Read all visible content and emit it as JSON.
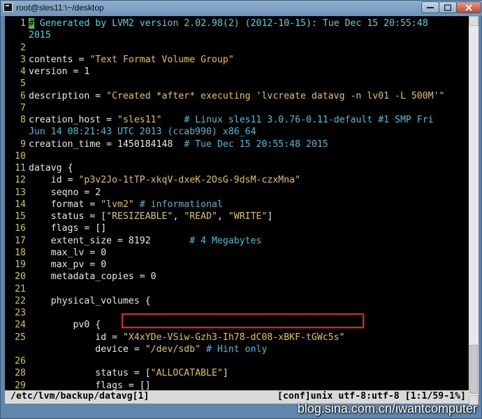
{
  "window": {
    "title": "root@sles11:\\~/desktop"
  },
  "terminal": {
    "lines": [
      {
        "n": "1",
        "parts": [
          {
            "t": "#",
            "c": "cursor"
          },
          {
            "t": " Generated by LVM2 version 2.02.98(2) (2012-10-15): Tue Dec 15 20:55:48",
            "c": "cyan"
          }
        ]
      },
      {
        "n": "",
        "parts": [
          {
            "t": "2015",
            "c": "cyan"
          }
        ]
      },
      {
        "n": "2",
        "parts": []
      },
      {
        "n": "3",
        "parts": [
          {
            "t": "contents = ",
            "c": ""
          },
          {
            "t": "\"Text Format Volume Group\"",
            "c": "str"
          }
        ]
      },
      {
        "n": "4",
        "parts": [
          {
            "t": "version = 1",
            "c": ""
          }
        ]
      },
      {
        "n": "5",
        "parts": []
      },
      {
        "n": "6",
        "parts": [
          {
            "t": "description = ",
            "c": ""
          },
          {
            "t": "\"Created *after* executing 'lvcreate datavg -n lv01 -L 500M'\"",
            "c": "str"
          }
        ]
      },
      {
        "n": "7",
        "parts": []
      },
      {
        "n": "8",
        "parts": [
          {
            "t": "creation_host = ",
            "c": ""
          },
          {
            "t": "\"sles11\"",
            "c": "str"
          },
          {
            "t": "    # Linux sles11 3.0.76-0.11-default #1 SMP Fri",
            "c": "com"
          }
        ]
      },
      {
        "n": "",
        "parts": [
          {
            "t": "Jun 14 08:21:43 UTC 2013 (ccab990) x86_64",
            "c": "com"
          }
        ]
      },
      {
        "n": "9",
        "parts": [
          {
            "t": "creation_time = 1450184148  ",
            "c": ""
          },
          {
            "t": "# Tue Dec 15 20:55:48 2015",
            "c": "com"
          }
        ]
      },
      {
        "n": "10",
        "parts": []
      },
      {
        "n": "11",
        "parts": [
          {
            "t": "datavg {",
            "c": ""
          }
        ]
      },
      {
        "n": "12",
        "parts": [
          {
            "t": "    id = ",
            "c": ""
          },
          {
            "t": "\"p3v2Jo-1tTP-xkqV-dxeK-2OsG-9dsM-czxMna\"",
            "c": "str"
          }
        ]
      },
      {
        "n": "13",
        "parts": [
          {
            "t": "    seqno = 2",
            "c": ""
          }
        ]
      },
      {
        "n": "14",
        "parts": [
          {
            "t": "    format = ",
            "c": ""
          },
          {
            "t": "\"lvm2\"",
            "c": "str"
          },
          {
            "t": " # informational",
            "c": "com"
          }
        ]
      },
      {
        "n": "15",
        "parts": [
          {
            "t": "    status = [",
            "c": ""
          },
          {
            "t": "\"RESIZEABLE\"",
            "c": "str"
          },
          {
            "t": ", ",
            "c": ""
          },
          {
            "t": "\"READ\"",
            "c": "str"
          },
          {
            "t": ", ",
            "c": ""
          },
          {
            "t": "\"WRITE\"",
            "c": "str"
          },
          {
            "t": "]",
            "c": ""
          }
        ]
      },
      {
        "n": "16",
        "parts": [
          {
            "t": "    flags = []",
            "c": ""
          }
        ]
      },
      {
        "n": "17",
        "parts": [
          {
            "t": "    extent_size = 8192       ",
            "c": ""
          },
          {
            "t": "# 4 Megabytes",
            "c": "com"
          }
        ]
      },
      {
        "n": "18",
        "parts": [
          {
            "t": "    max_lv = 0",
            "c": ""
          }
        ]
      },
      {
        "n": "19",
        "parts": [
          {
            "t": "    max_pv = 0",
            "c": ""
          }
        ]
      },
      {
        "n": "20",
        "parts": [
          {
            "t": "    metadata_copies = 0",
            "c": ""
          }
        ]
      },
      {
        "n": "21",
        "parts": []
      },
      {
        "n": "22",
        "parts": [
          {
            "t": "    physical_volumes {",
            "c": ""
          }
        ]
      },
      {
        "n": "23",
        "parts": []
      },
      {
        "n": "24",
        "parts": [
          {
            "t": "        pv0 {",
            "c": ""
          }
        ]
      },
      {
        "n": "25",
        "parts": [
          {
            "t": "            id = ",
            "c": ""
          },
          {
            "t": "\"X4xYDe-VSiw-Gzh3-Ih78-dC08-xBKF-tGWc5s\"",
            "c": "str"
          }
        ]
      },
      {
        "n": "",
        "parts": [
          {
            "t": "            device = ",
            "c": ""
          },
          {
            "t": "\"/dev/sdb\"",
            "c": "str"
          },
          {
            "t": " # Hint only",
            "c": "com"
          }
        ]
      },
      {
        "n": "26",
        "parts": []
      },
      {
        "n": "28",
        "parts": [
          {
            "t": "            status = [",
            "c": ""
          },
          {
            "t": "\"ALLOCATABLE\"",
            "c": "str"
          },
          {
            "t": "]",
            "c": ""
          }
        ]
      },
      {
        "n": "29",
        "parts": [
          {
            "t": "            flags = []",
            "c": ""
          }
        ]
      }
    ]
  },
  "statusbar": {
    "file": "/etc/lvm/backup/datavg[1]",
    "info": "[conf]unix utf-8:utf-8 [1:1/59-1%]"
  },
  "watermark": "blog.sina.com.cn/iwantcomputer",
  "icons": [
    "terminal-app-icon",
    "minimize-icon",
    "maximize-icon",
    "close-icon"
  ]
}
